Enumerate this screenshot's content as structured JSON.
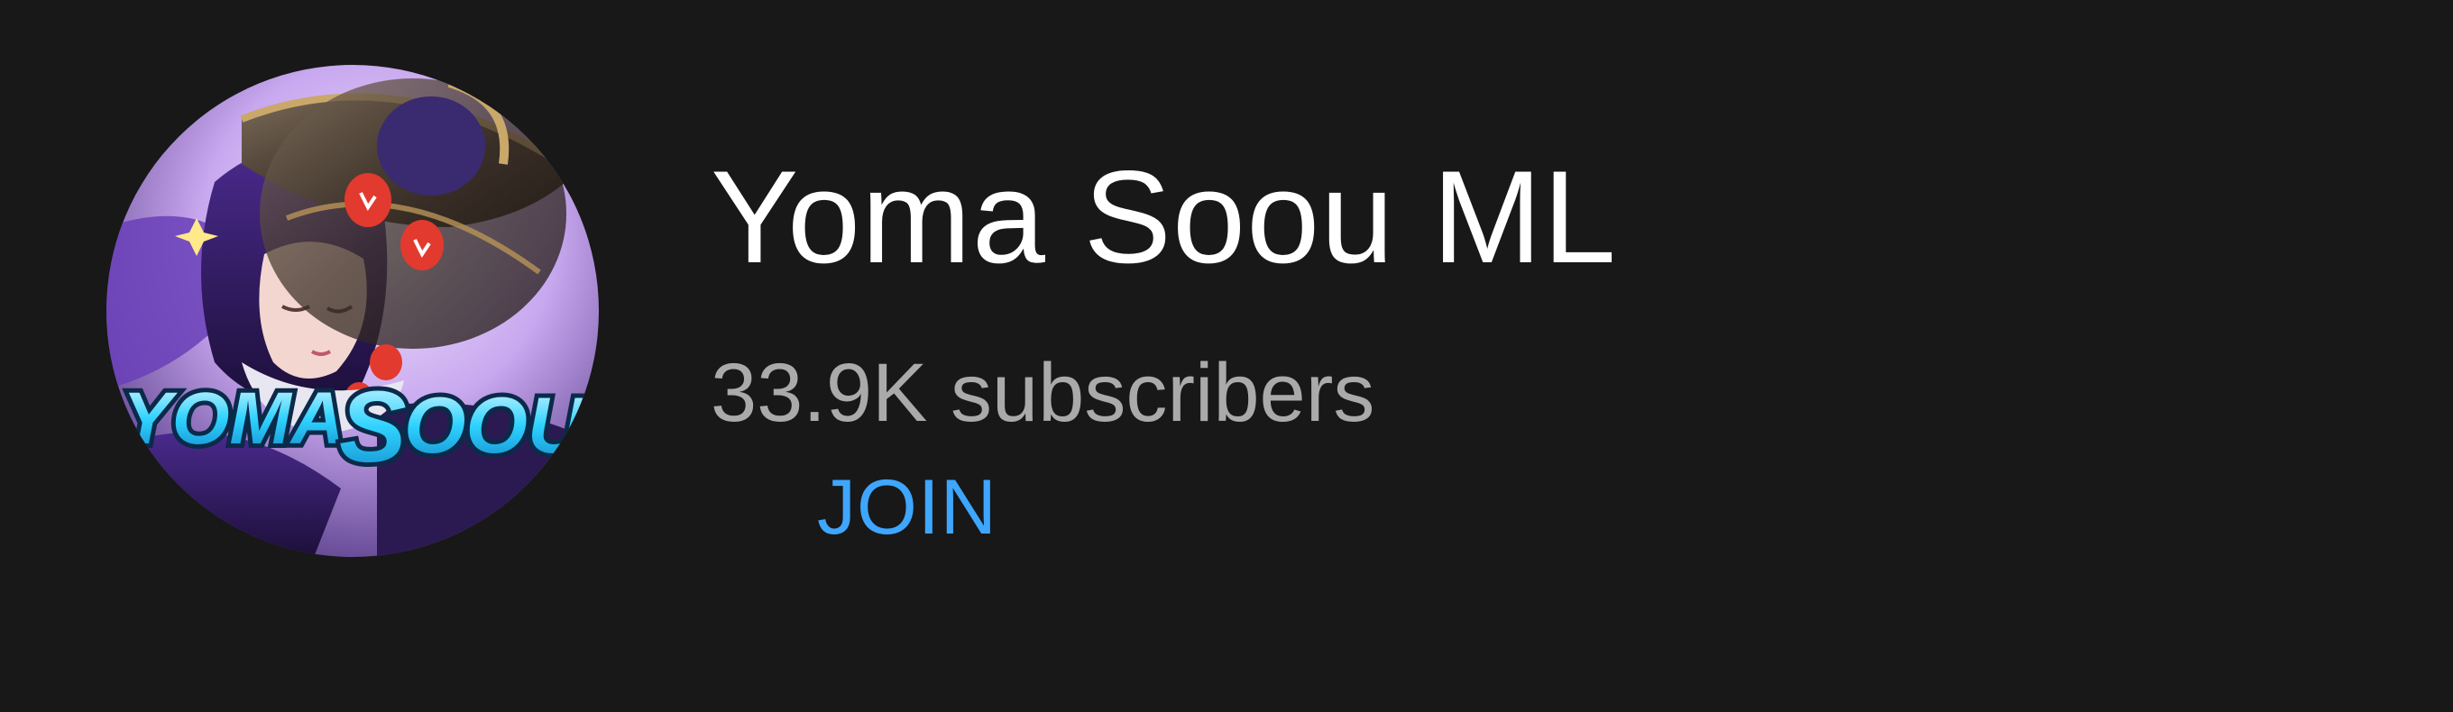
{
  "channel": {
    "name": "Yoma Soou ML",
    "subscribers": "33.9K subscribers",
    "join_label": "JOIN",
    "avatar_text": "YOMA SOOU",
    "avatar_icon": "channel-avatar-icon"
  },
  "colors": {
    "background": "#181818",
    "name_text": "#ffffff",
    "subscriber_text": "#aaaaaa",
    "join_text": "#3ea6ff",
    "avatar_purple": "#5b3aa8",
    "avatar_cyan": "#2fd3ff"
  }
}
